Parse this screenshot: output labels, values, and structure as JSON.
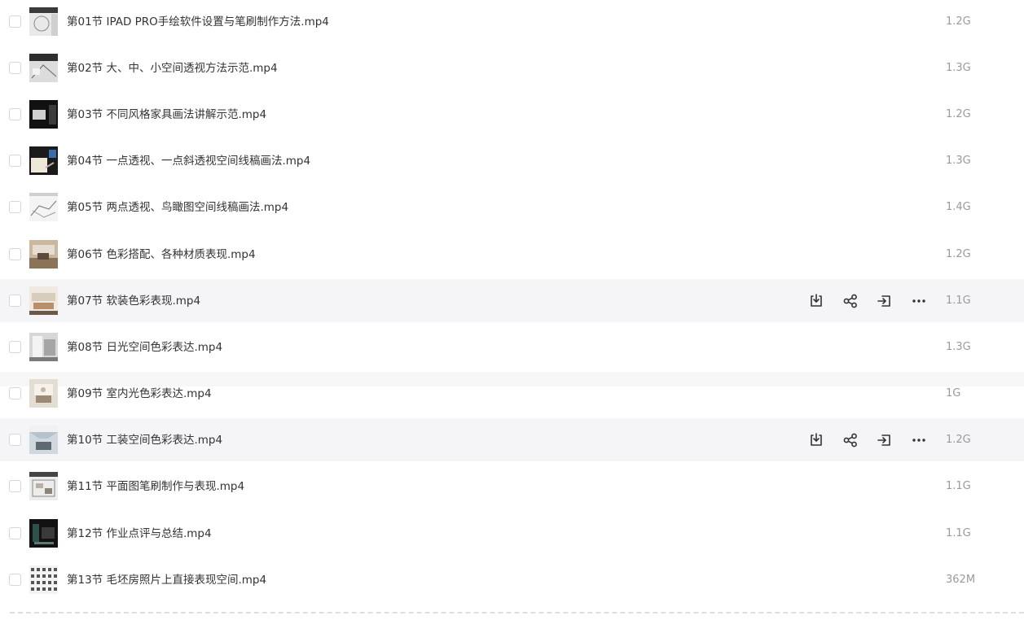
{
  "files": [
    {
      "name": "第01节 IPAD PRO手绘软件设置与笔刷制作方法.mp4",
      "size": "1.2G"
    },
    {
      "name": "第02节 大、中、小空间透视方法示范.mp4",
      "size": "1.3G"
    },
    {
      "name": "第03节 不同风格家具画法讲解示范.mp4",
      "size": "1.2G"
    },
    {
      "name": "第04节 一点透视、一点斜透视空间线稿画法.mp4",
      "size": "1.3G"
    },
    {
      "name": "第05节 两点透视、鸟瞰图空间线稿画法.mp4",
      "size": "1.4G"
    },
    {
      "name": "第06节 色彩搭配、各种材质表现.mp4",
      "size": "1.2G"
    },
    {
      "name": "第07节 软装色彩表现.mp4",
      "size": "1.1G"
    },
    {
      "name": "第08节 日光空间色彩表达.mp4",
      "size": "1.3G"
    },
    {
      "name": "第09节 室内光色彩表达.mp4",
      "size": "1G"
    },
    {
      "name": "第10节 工装空间色彩表达.mp4",
      "size": "1.2G"
    },
    {
      "name": "第11节 平面图笔刷制作与表现.mp4",
      "size": "1.1G"
    },
    {
      "name": "第12节 作业点评与总结.mp4",
      "size": "1.1G"
    },
    {
      "name": "第13节 毛坯房照片上直接表现空间.mp4",
      "size": "362M"
    }
  ],
  "actions": [
    "download-icon",
    "share-icon",
    "move-icon",
    "more-icon"
  ],
  "colors": {
    "hover_bg": "#f5f5f7",
    "text": "#333333",
    "size_text": "#9a9a9a"
  }
}
